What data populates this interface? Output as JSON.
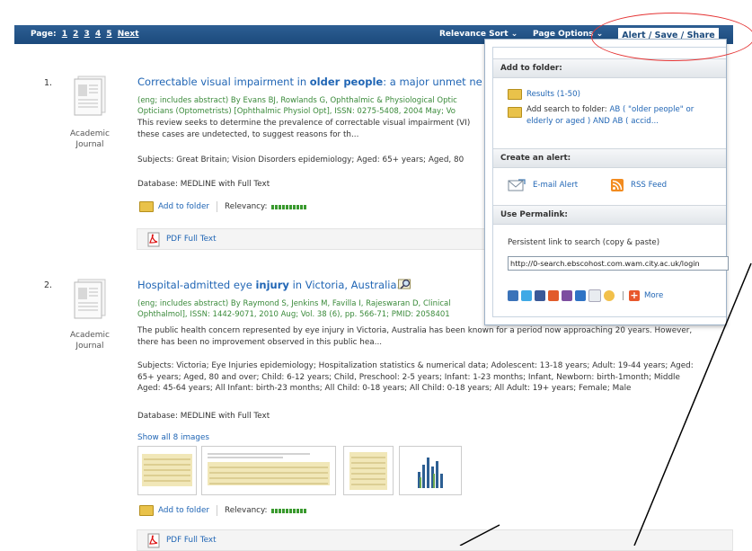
{
  "toolbar": {
    "page_label": "Page:",
    "pages": [
      "1",
      "2",
      "3",
      "4",
      "5"
    ],
    "next": "Next",
    "relevance_sort": "Relevance Sort",
    "page_options": "Page Options",
    "alert_save_share": "Alert / Save / Share"
  },
  "results": [
    {
      "number": "1.",
      "doc_type_line1": "Academic",
      "doc_type_line2": "Journal",
      "title_pre": "Correctable visual impairment in ",
      "title_bold": "older people",
      "title_post": ": a major unmet ne",
      "meta_line1": "(eng; includes abstract) By Evans BJ, Rowlands G, Ophthalmic & Physiological Optic",
      "meta_line2": "Opticians (Optometrists) [Ophthalmic Physiol Opt], ISSN: 0275-5408, 2004 May; Vo",
      "abstract_line1": "This review seeks to determine the prevalence of correctable visual impairment (VI)",
      "abstract_line2": "these cases are undetected, to suggest reasons for th...",
      "subjects": "Subjects: Great Britain; Vision Disorders epidemiology; Aged: 65+ years; Aged, 80",
      "database": "Database: MEDLINE with Full Text",
      "add_to_folder": "Add to folder",
      "relevancy_label": "Relevancy:",
      "pdf": "PDF Full Text"
    },
    {
      "number": "2.",
      "doc_type_line1": "Academic",
      "doc_type_line2": "Journal",
      "title_pre": "Hospital-admitted eye ",
      "title_bold": "injury",
      "title_post": " in Victoria, Australia.",
      "meta_line1": "(eng; includes abstract) By Raymond S, Jenkins M, Favilla I, Rajeswaran D, Clinical",
      "meta_line2": "Ophthalmol], ISSN: 1442-9071, 2010 Aug; Vol. 38 (6), pp. 566-71; PMID: 2058401",
      "abstract_line1": "The public health concern represented by eye injury in Victoria, Australia has been known for a period now approaching 20 years. However,",
      "abstract_line2": "there has been no improvement observed in this public hea...",
      "subjects_line1": "Subjects: Victoria; Eye Injuries epidemiology; Hospitalization statistics & numerical data; Adolescent: 13-18 years; Adult: 19-44 years; Aged:",
      "subjects_line2": "65+ years; Aged, 80 and over; Child: 6-12 years; Child, Preschool: 2-5 years; Infant: 1-23 months; Infant, Newborn: birth-1month; Middle",
      "subjects_line3": "Aged: 45-64 years; All Infant: birth-23 months; All Child: 0-18 years; All Child: 0-18 years; All Adult: 19+ years; Female; Male",
      "database": "Database: MEDLINE with Full Text",
      "show_images": "Show all 8 images",
      "add_to_folder": "Add to folder",
      "relevancy_label": "Relevancy:",
      "pdf": "PDF Full Text"
    }
  ],
  "panel": {
    "add_folder_header": "Add to folder:",
    "results_link": "Results (1-50)",
    "add_search_label": "Add search to folder: ",
    "add_search_link_line1": "AB ( \"older people\" or",
    "add_search_link_line2": "elderly or aged ) AND AB ( accid...",
    "create_alert_header": "Create an alert:",
    "email_alert": "E-mail Alert",
    "rss_feed": "RSS Feed",
    "permalink_header": "Use Permalink:",
    "permalink_label": "Persistent link to search (copy & paste)",
    "permalink_value": "http://0-search.ebscohost.com.wam.city.ac.uk/login",
    "more": "More"
  },
  "colors": {
    "toolbar": "#1b4a7c",
    "link": "#2166b5",
    "meta_green": "#3a8a3a",
    "annotation_red": "#e53535"
  }
}
